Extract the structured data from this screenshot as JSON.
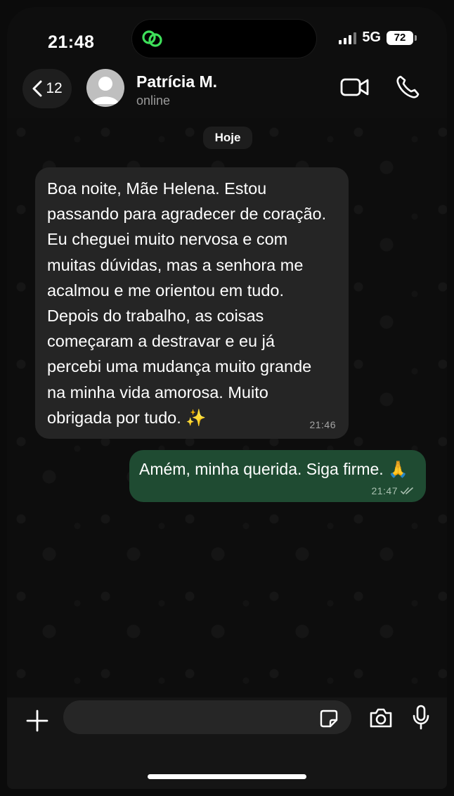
{
  "status_bar": {
    "time": "21:48",
    "network": "5G",
    "battery": "72"
  },
  "header": {
    "back_count": "12",
    "contact_name": "Patrícia M.",
    "contact_status": "online"
  },
  "chat": {
    "date_label": "Hoje",
    "messages": [
      {
        "direction": "incoming",
        "lines": [
          "Boa noite, Mãe Helena. Estou",
          "passando para agradecer de coração.",
          "Eu cheguei muito nervosa e com",
          "muitas dúvidas, mas a senhora me",
          "acalmou e me orientou em tudo.",
          "Depois do trabalho, as coisas",
          "começaram a destravar e eu já",
          "percebi uma mudança muito grande",
          "na minha vida amorosa. Muito",
          "obrigada por tudo. ✨"
        ],
        "time": "21:46"
      },
      {
        "direction": "outgoing",
        "text": "Amém, minha querida. Siga firme. 🙏",
        "time": "21:47",
        "status": "read"
      }
    ]
  },
  "composer": {
    "placeholder": ""
  },
  "colors": {
    "incoming_bubble": "#252525",
    "outgoing_bubble": "#1f4b32",
    "background": "#0e0e0e",
    "island_icon": "#3ee05a"
  }
}
